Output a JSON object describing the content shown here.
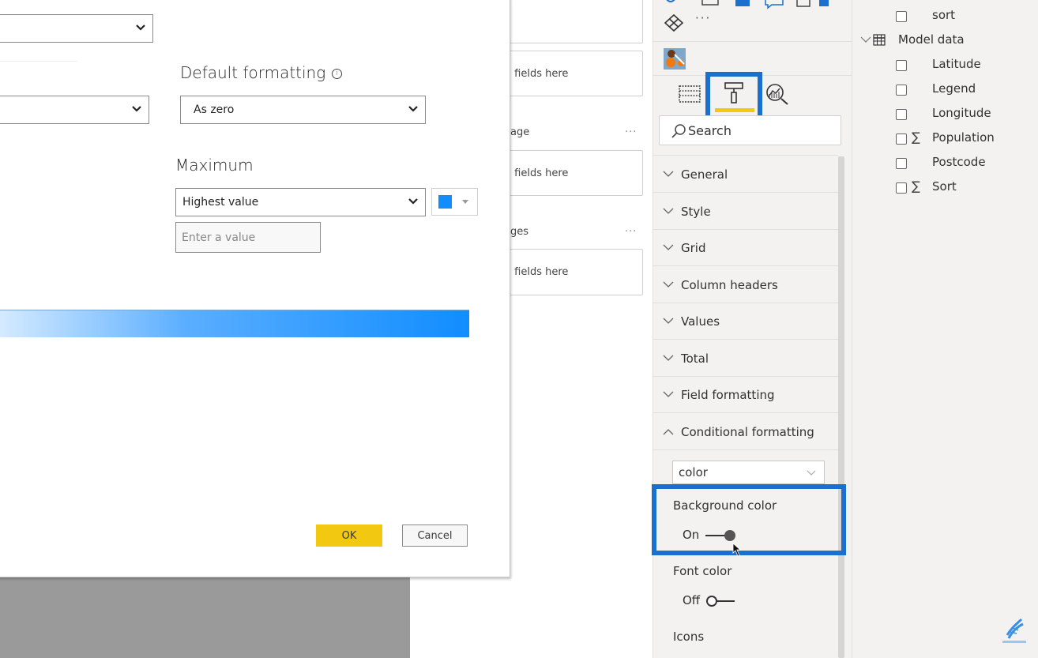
{
  "dialog": {
    "top_select_value": "",
    "second_select_value": "",
    "default_formatting": {
      "heading": "Default formatting",
      "info_icon": "info-icon",
      "selected": "As zero"
    },
    "maximum": {
      "heading": "Maximum",
      "selected": "Highest value",
      "color": "#118dff",
      "value_placeholder": "Enter a value"
    },
    "gradient": {
      "from": "#d6ebff",
      "to": "#118dff"
    },
    "ok_label": "OK",
    "cancel_label": "Cancel"
  },
  "fields_wells": {
    "wells": [
      {
        "placeholder": ""
      },
      {
        "placeholder": "ata fields here"
      },
      {
        "label": "age",
        "placeholder": "ata fields here",
        "more": "···"
      },
      {
        "label": "ges",
        "placeholder": "ata fields here",
        "more": "···"
      }
    ]
  },
  "visualizations": {
    "more_label": "···",
    "tabs": [
      {
        "name": "fields-tab",
        "icon": "table-fields-icon"
      },
      {
        "name": "format-tab",
        "icon": "paint-roller-icon",
        "active": true
      },
      {
        "name": "analytics-tab",
        "icon": "analytics-magnifier-icon"
      }
    ],
    "search_placeholder": "Search",
    "sections": [
      {
        "label": "General",
        "expanded": false
      },
      {
        "label": "Style",
        "expanded": false
      },
      {
        "label": "Grid",
        "expanded": false
      },
      {
        "label": "Column headers",
        "expanded": false
      },
      {
        "label": "Values",
        "expanded": false
      },
      {
        "label": "Total",
        "expanded": false
      },
      {
        "label": "Field formatting",
        "expanded": false
      },
      {
        "label": "Conditional formatting",
        "expanded": true
      }
    ],
    "conditional_formatting": {
      "field_select": "color",
      "background_color": {
        "label": "Background color",
        "state": "On"
      },
      "font_color": {
        "label": "Font color",
        "state": "Off"
      },
      "icons_label": "Icons"
    },
    "accent_highlight": "#1a6fcf",
    "active_tab_underline": "#f2c811"
  },
  "fields": {
    "items": [
      {
        "name": "sort",
        "sigma": false,
        "indent": true
      },
      {
        "name": "Model data",
        "table": true
      },
      {
        "name": "Latitude",
        "sigma": false
      },
      {
        "name": "Legend",
        "sigma": false
      },
      {
        "name": "Longitude",
        "sigma": false
      },
      {
        "name": "Population",
        "sigma": true
      },
      {
        "name": "Postcode",
        "sigma": false
      },
      {
        "name": "Sort",
        "sigma": true
      }
    ]
  }
}
